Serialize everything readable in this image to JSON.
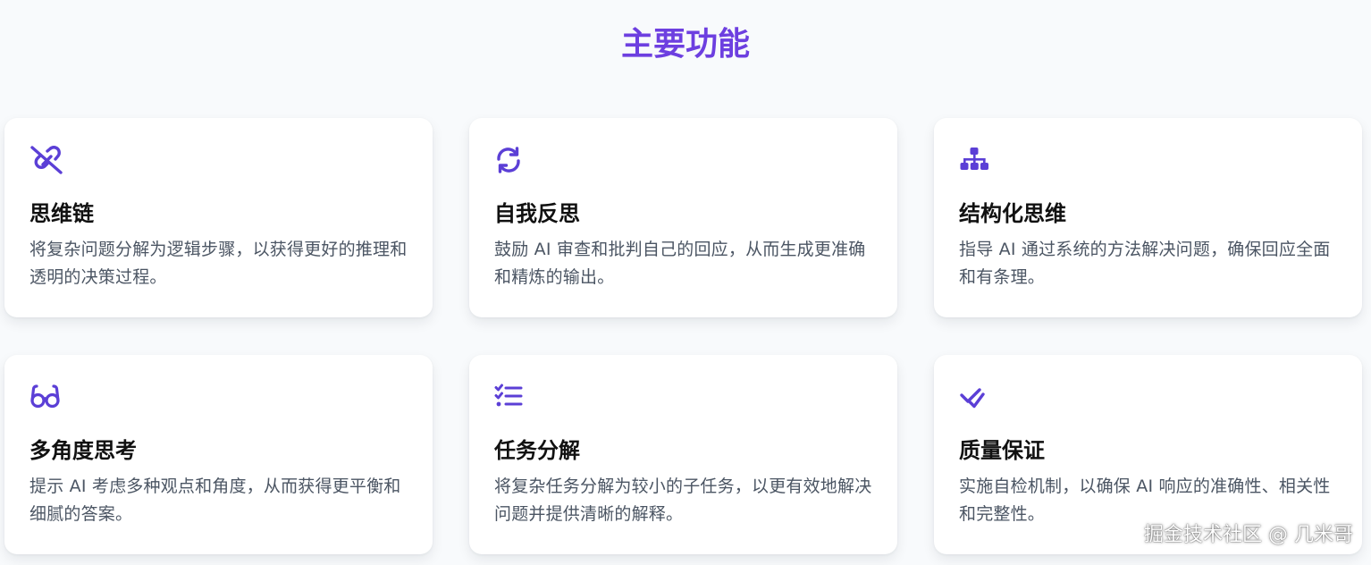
{
  "section": {
    "title": "主要功能"
  },
  "colors": {
    "accent": "#6d3fe0",
    "icon": "#5b3fd6",
    "background": "#f8fafc"
  },
  "features": [
    {
      "icon": "unlink-icon",
      "title": "思维链",
      "desc": "将复杂问题分解为逻辑步骤，以获得更好的推理和透明的决策过程。"
    },
    {
      "icon": "refresh-icon",
      "title": "自我反思",
      "desc": "鼓励 AI 审查和批判自己的回应，从而生成更准确和精炼的输出。"
    },
    {
      "icon": "sitemap-icon",
      "title": "结构化思维",
      "desc": "指导 AI 通过系统的方法解决问题，确保回应全面和有条理。"
    },
    {
      "icon": "glasses-icon",
      "title": "多角度思考",
      "desc": "提示 AI 考虑多种观点和角度，从而获得更平衡和细腻的答案。"
    },
    {
      "icon": "checklist-icon",
      "title": "任务分解",
      "desc": "将复杂任务分解为较小的子任务，以更有效地解决问题并提供清晰的解释。"
    },
    {
      "icon": "double-check-icon",
      "title": "质量保证",
      "desc": "实施自检机制，以确保 AI 响应的准确性、相关性和完整性。"
    }
  ],
  "watermark": "掘金技术社区 @ 几米哥"
}
